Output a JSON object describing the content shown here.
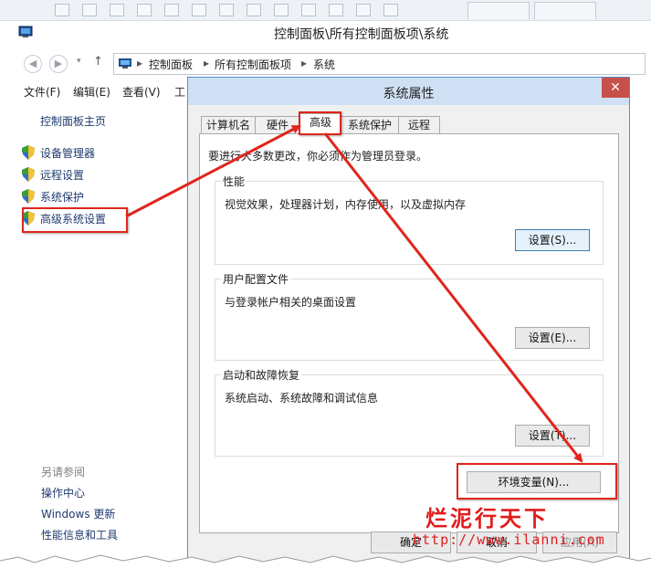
{
  "control_panel": {
    "title": "控制面板\\所有控制面板项\\系统",
    "breadcrumbs": [
      "控制面板",
      "所有控制面板项",
      "系统"
    ],
    "menu": [
      "文件(F)",
      "编辑(E)",
      "查看(V)",
      "工"
    ],
    "sidebar_home": "控制面板主页",
    "sidebar_items": [
      "设备管理器",
      "远程设置",
      "系统保护",
      "高级系统设置"
    ],
    "see_also_heading": "另请参阅",
    "see_also_links": [
      "操作中心",
      "Windows 更新",
      "性能信息和工具"
    ]
  },
  "dialog": {
    "title": "系统属性",
    "close_glyph": "✕",
    "tabs": [
      "计算机名",
      "硬件",
      "高级",
      "系统保护",
      "远程"
    ],
    "notice": "要进行大多数更改，你必须作为管理员登录。",
    "groups": [
      {
        "title": "性能",
        "desc": "视觉效果，处理器计划，内存使用，以及虚拟内存",
        "button": "设置(S)..."
      },
      {
        "title": "用户配置文件",
        "desc": "与登录帐户相关的桌面设置",
        "button": "设置(E)..."
      },
      {
        "title": "启动和故障恢复",
        "desc": "系统启动、系统故障和调试信息",
        "button": "设置(T)..."
      }
    ],
    "env_button": "环境变量(N)...",
    "ok_button": "确定",
    "cancel_button": "取消",
    "apply_button": "应用(A)"
  },
  "watermark": {
    "brand": "烂泥行天下",
    "url": "http://www.ilanni.com"
  },
  "colors": {
    "annotation_red": "#e0251c",
    "dialog_border": "#5a8fcb",
    "link_blue": "#1e3a6e"
  }
}
